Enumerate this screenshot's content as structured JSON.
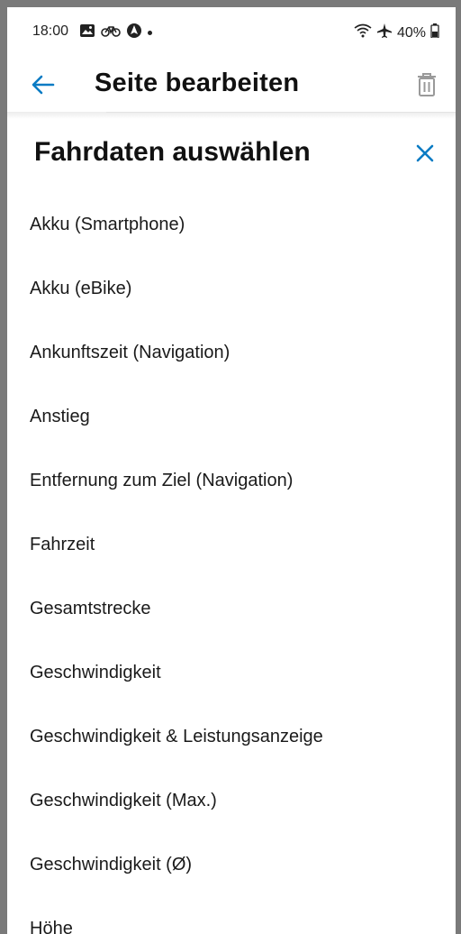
{
  "status_bar": {
    "time": "18:00",
    "battery": "40%",
    "icons_left": [
      "image-icon",
      "bike-icon",
      "navigation-icon"
    ],
    "icons_right": [
      "wifi-icon",
      "airplane-icon",
      "battery-icon"
    ]
  },
  "app_bar": {
    "title": "Seite bearbeiten"
  },
  "sheet": {
    "title": "Fahrdaten auswählen",
    "items": [
      "Akku (Smartphone)",
      "Akku (eBike)",
      "Ankunftszeit (Navigation)",
      "Anstieg",
      "Entfernung zum Ziel (Navigation)",
      "Fahrzeit",
      "Gesamtstrecke",
      "Geschwindigkeit",
      "Geschwindigkeit & Leistungsanzeige",
      "Geschwindigkeit (Max.)",
      "Geschwindigkeit (Ø)",
      "Höhe"
    ]
  },
  "colors": {
    "accent": "#0a7bc4",
    "text": "#111111",
    "muted_icon": "#9a9a9a",
    "frame": "#7a7a7a"
  }
}
